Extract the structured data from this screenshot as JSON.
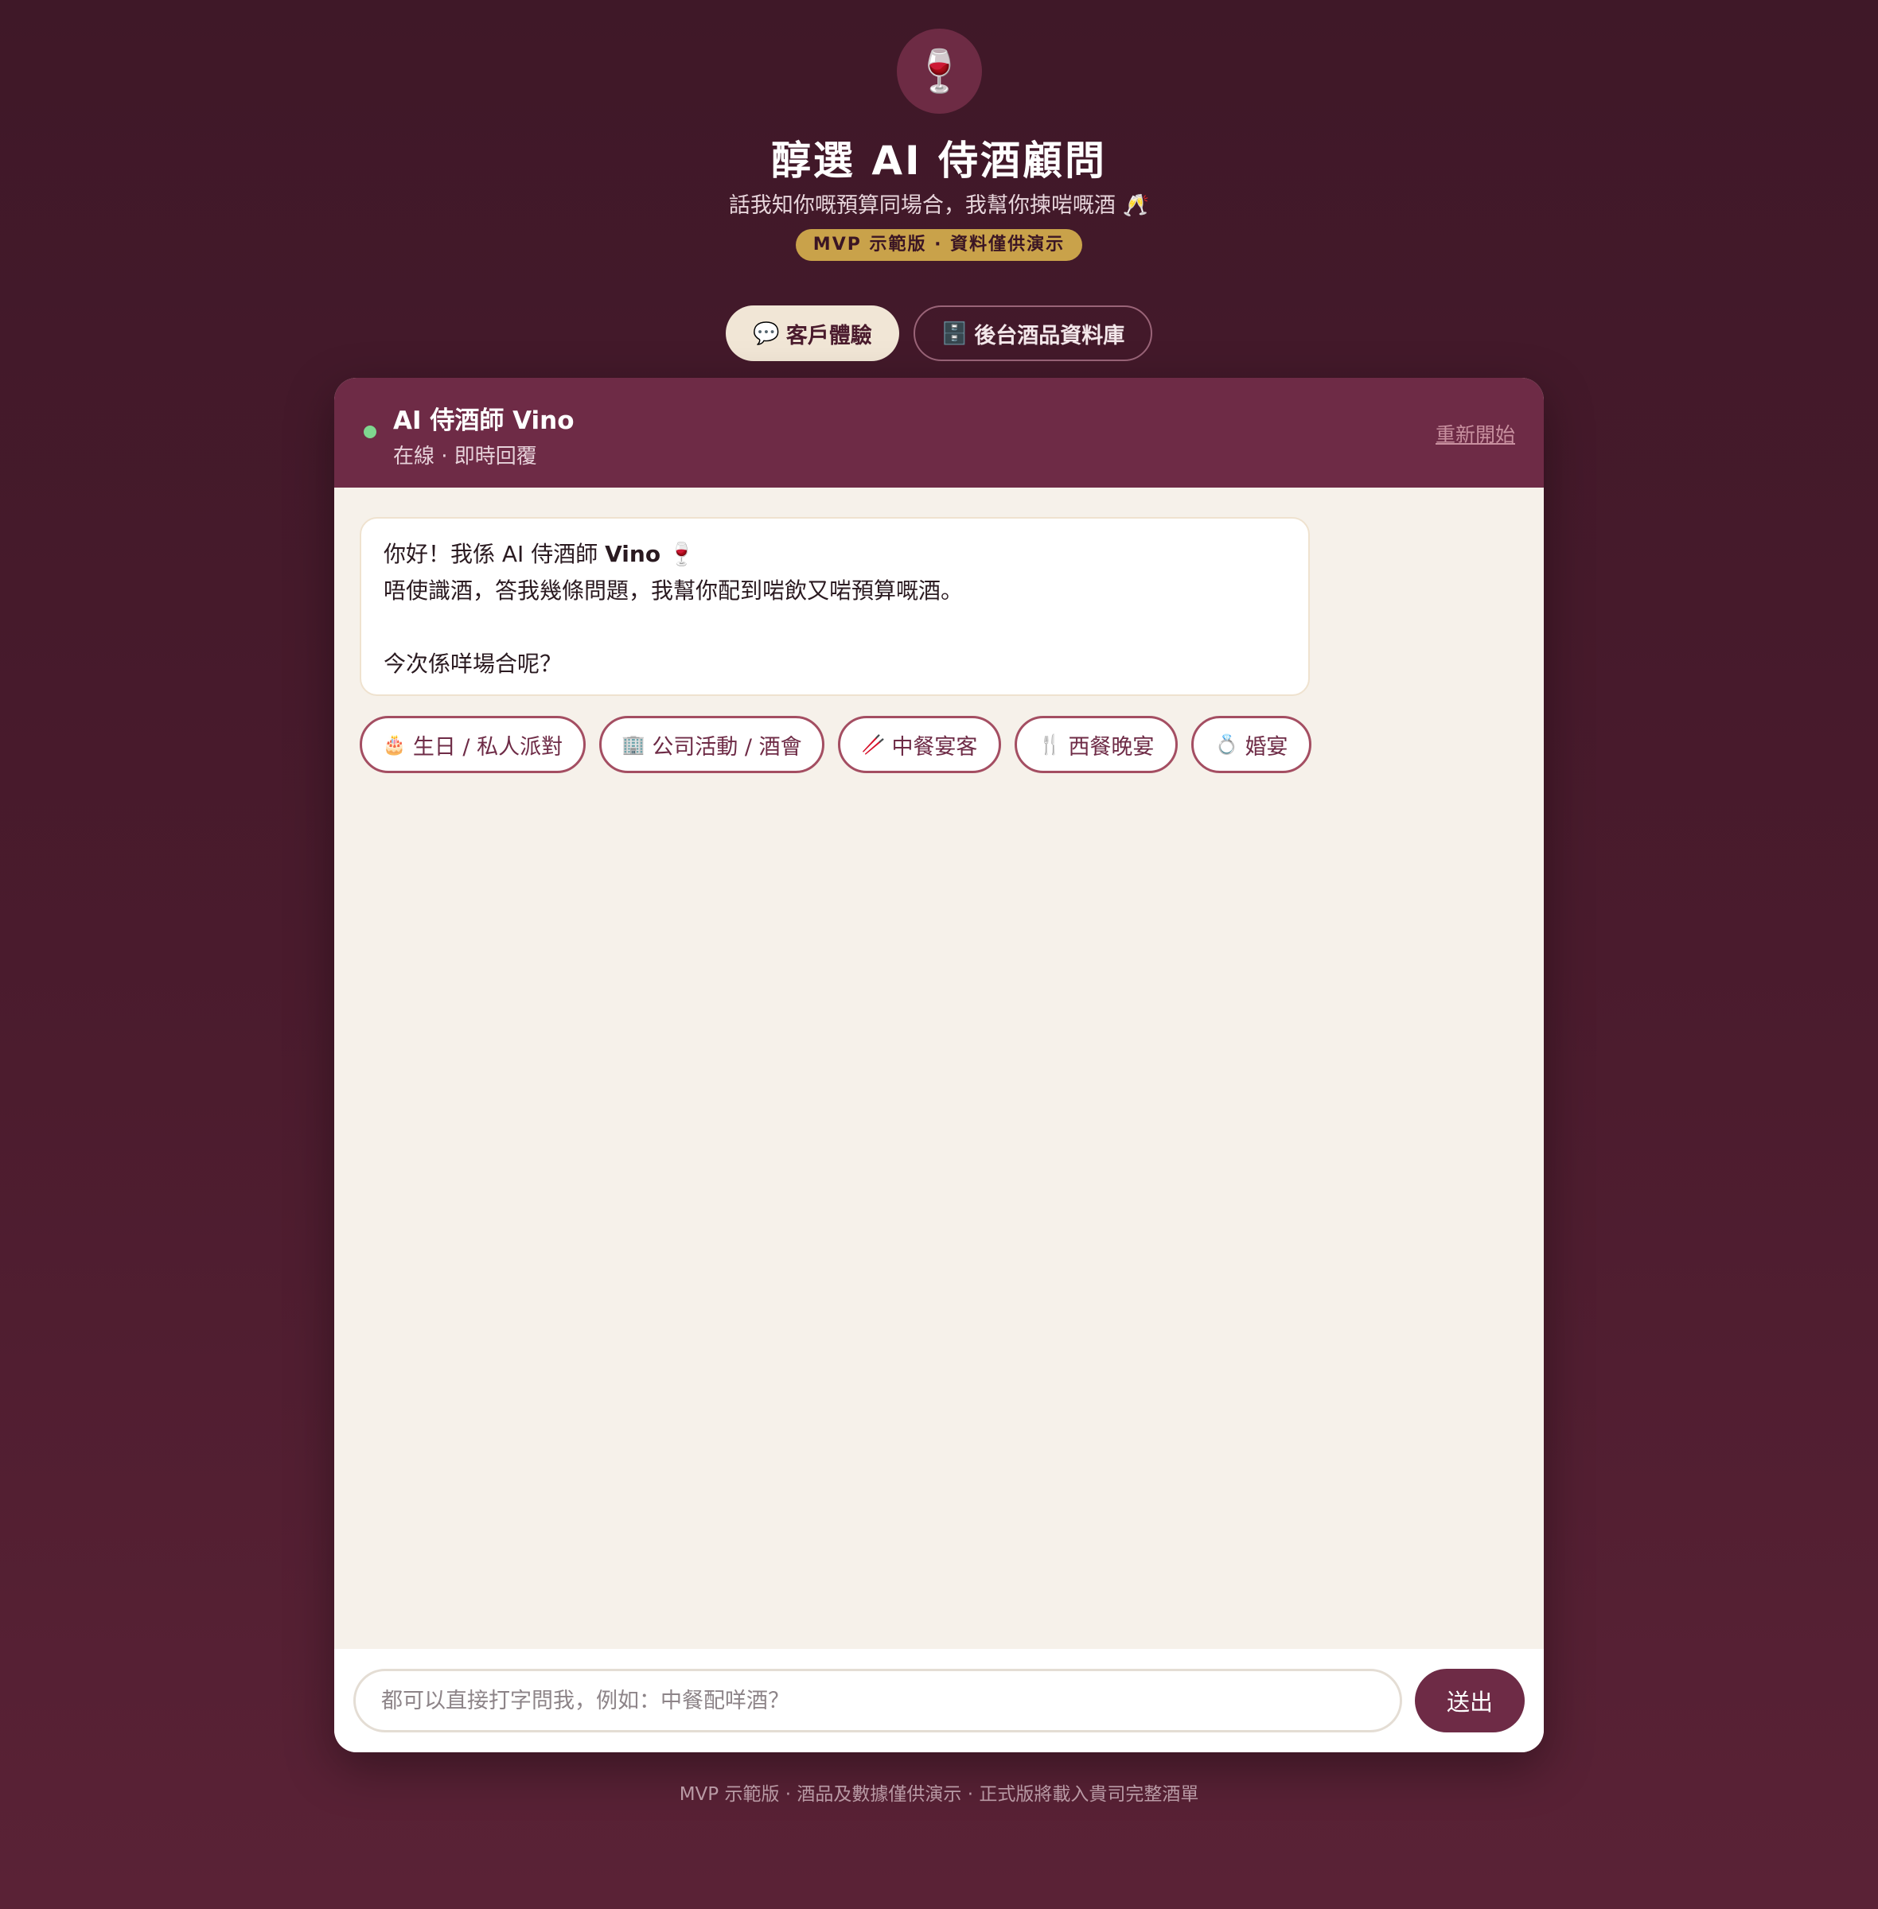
{
  "header": {
    "logo_icon": "wine-glass-icon",
    "logo_glyph": "🍷",
    "title": "醇選 AI 侍酒顧問",
    "subtitle": "話我知你嘅預算同場合，我幫你揀啱嘅酒 🥂",
    "badge": "MVP 示範版 · 資料僅供演示"
  },
  "tabs": [
    {
      "icon": "💬",
      "label": "客戶體驗",
      "active": true
    },
    {
      "icon": "🗄️",
      "label": "後台酒品資料庫",
      "active": false
    }
  ],
  "chat": {
    "agent_name": "AI 侍酒師 Vino",
    "status": "在線 · 即時回覆",
    "restart_label": "重新開始",
    "message": {
      "line1_prefix": "你好！我係 AI 侍酒師 ",
      "line1_bold": "Vino",
      "line1_emoji": " 🍷",
      "line2": "唔使識酒，答我幾條問題，我幫你配到啱飲又啱預算嘅酒。",
      "line3": "今次係咩場合呢？"
    },
    "chips": [
      {
        "icon": "🎂",
        "label": "生日 / 私人派對"
      },
      {
        "icon": "🏢",
        "label": "公司活動 / 酒會"
      },
      {
        "icon": "🥢",
        "label": "中餐宴客"
      },
      {
        "icon": "🍴",
        "label": "西餐晚宴"
      },
      {
        "icon": "💍",
        "label": "婚宴"
      }
    ],
    "input_placeholder": "都可以直接打字問我，例如：中餐配咩酒？",
    "send_label": "送出"
  },
  "footer": "MVP 示範版 · 酒品及數據僅供演示 · 正式版將載入貴司完整酒單",
  "colors": {
    "background": "#4a1b2d",
    "accent": "#6e2b46",
    "badge": "#c9a24a",
    "online": "#7fd68f"
  }
}
